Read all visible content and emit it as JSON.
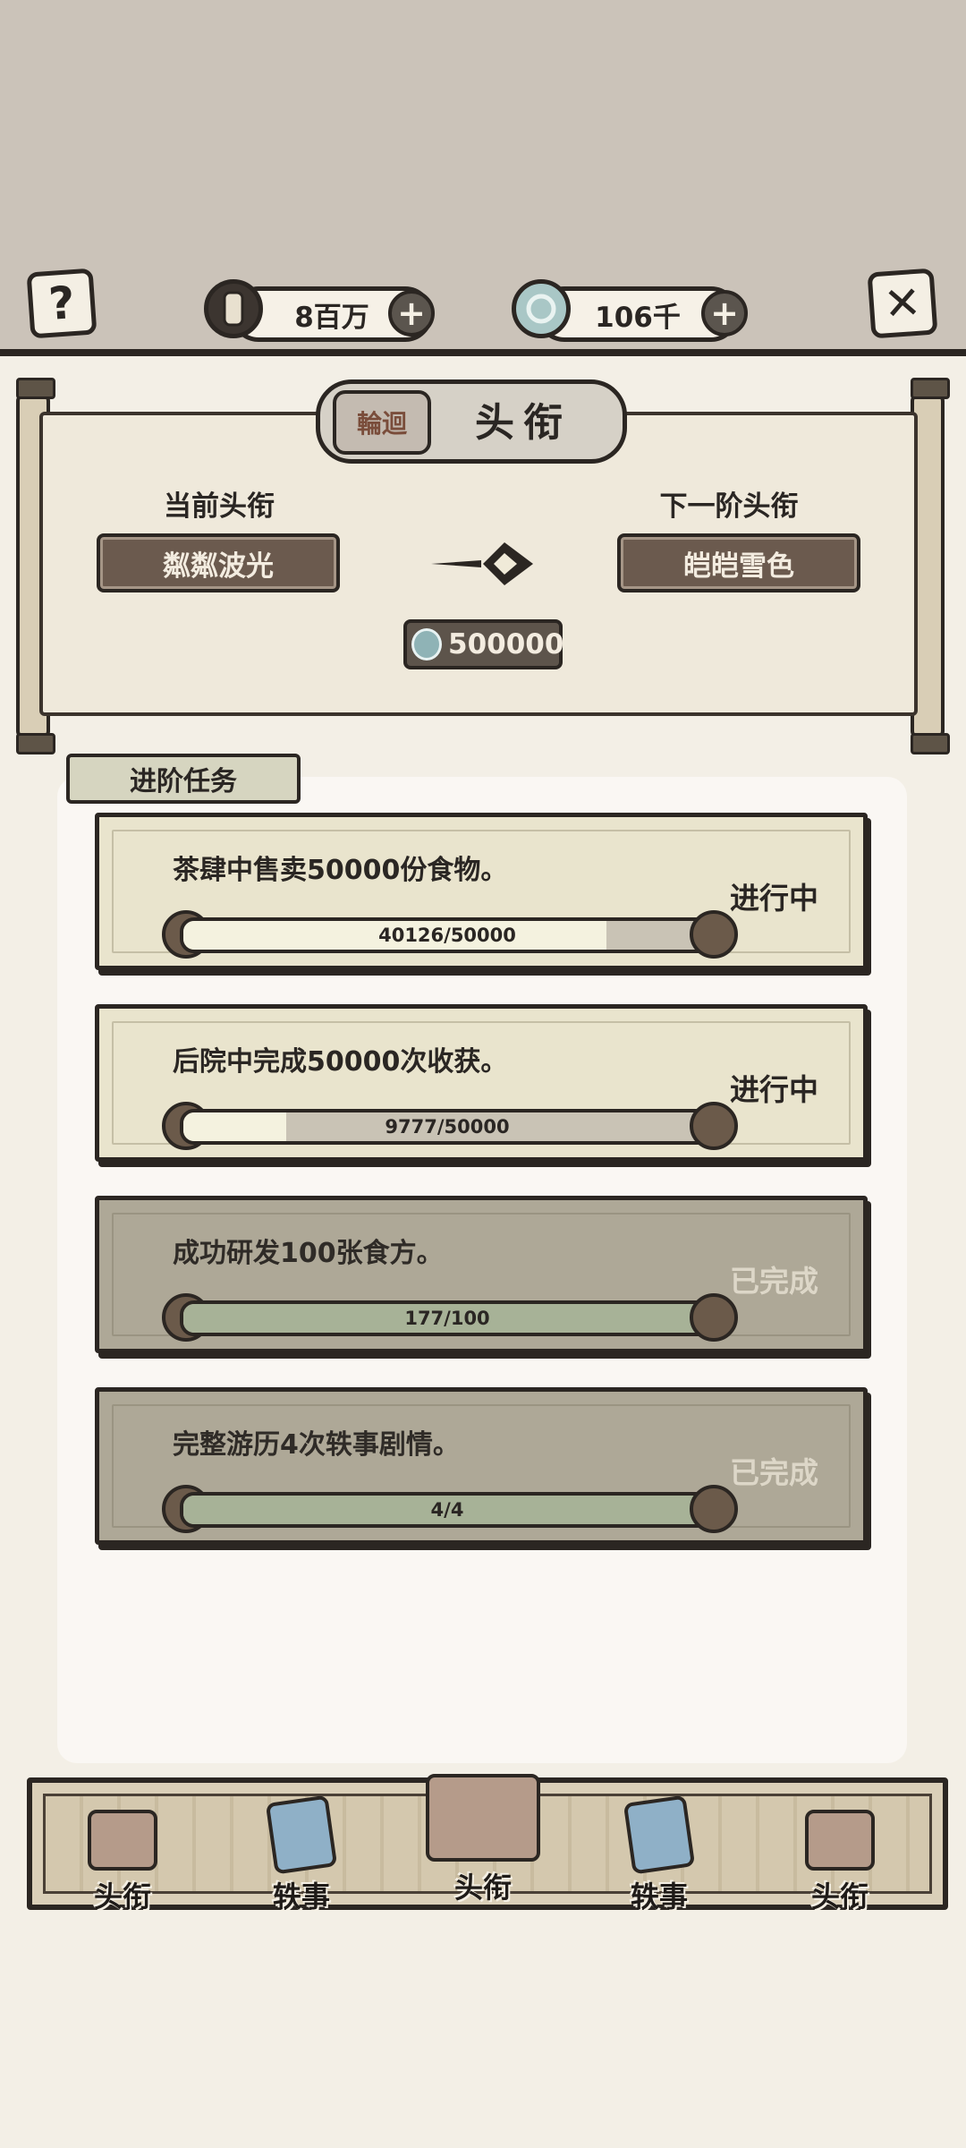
{
  "header": {
    "help_icon": "question-mark",
    "close_icon": "x-mark",
    "coins": {
      "icon": "coin-icon",
      "value": "8百万"
    },
    "gems": {
      "icon": "jade-icon",
      "value": "106千"
    }
  },
  "title_panel": {
    "title": "头衔",
    "seal_text": "輪迴",
    "current_label": "当前头衔",
    "current_rank": "粼粼波光",
    "next_label": "下一阶头衔",
    "next_rank": "皑皑雪色",
    "cost": "500000"
  },
  "tasks": {
    "section_title": "进阶任务",
    "items": [
      {
        "desc": "茶肆中售卖50000份食物。",
        "progress_text": "40126/50000",
        "progress": 0.8025,
        "status": "进行中",
        "state": "active"
      },
      {
        "desc": "后院中完成50000次收获。",
        "progress_text": "9777/50000",
        "progress": 0.1955,
        "status": "进行中",
        "state": "active"
      },
      {
        "desc": "成功研发100张食方。",
        "progress_text": "177/100",
        "progress": 1.0,
        "status": "已完成",
        "state": "done"
      },
      {
        "desc": "完整游历4次轶事剧情。",
        "progress_text": "4/4",
        "progress": 1.0,
        "status": "已完成",
        "state": "done"
      }
    ]
  },
  "bottom_nav": {
    "items": [
      {
        "label": "头衔",
        "icon": "seal-icon"
      },
      {
        "label": "轶事",
        "icon": "scroll-icon"
      },
      {
        "label": "头衔",
        "icon": "seal-icon"
      },
      {
        "label": "轶事",
        "icon": "scroll-icon"
      },
      {
        "label": "头衔",
        "icon": "seal-icon"
      }
    ]
  }
}
